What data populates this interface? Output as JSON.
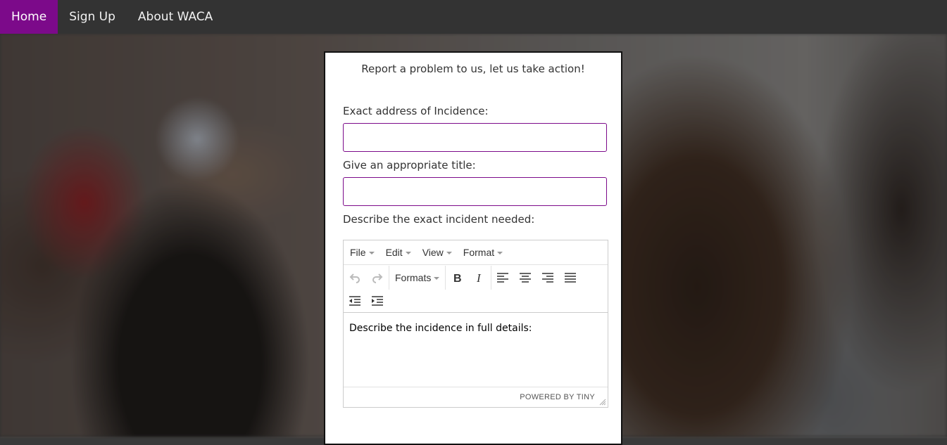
{
  "nav": {
    "items": [
      {
        "label": "Home",
        "active": true
      },
      {
        "label": "Sign Up",
        "active": false
      },
      {
        "label": "About WACA",
        "active": false
      }
    ]
  },
  "form": {
    "heading": "Report a problem to us, let us take action!",
    "address_label": "Exact address of Incidence:",
    "address_value": "",
    "title_label": "Give an appropriate title:",
    "title_value": "",
    "description_label": "Describe the exact incident needed:"
  },
  "editor": {
    "menu": [
      "File",
      "Edit",
      "View",
      "Format"
    ],
    "formats_label": "Formats",
    "toolbar_icons": [
      "undo-icon",
      "redo-icon",
      "bold-icon",
      "italic-icon",
      "align-left-icon",
      "align-center-icon",
      "align-right-icon",
      "align-justify-icon",
      "outdent-icon",
      "indent-icon"
    ],
    "content": "Describe the incidence in full details:",
    "powered_by": "POWERED BY TINY"
  },
  "colors": {
    "nav_bg": "#333333",
    "nav_active": "#7c0a8a",
    "input_border": "#7c0a8a"
  }
}
